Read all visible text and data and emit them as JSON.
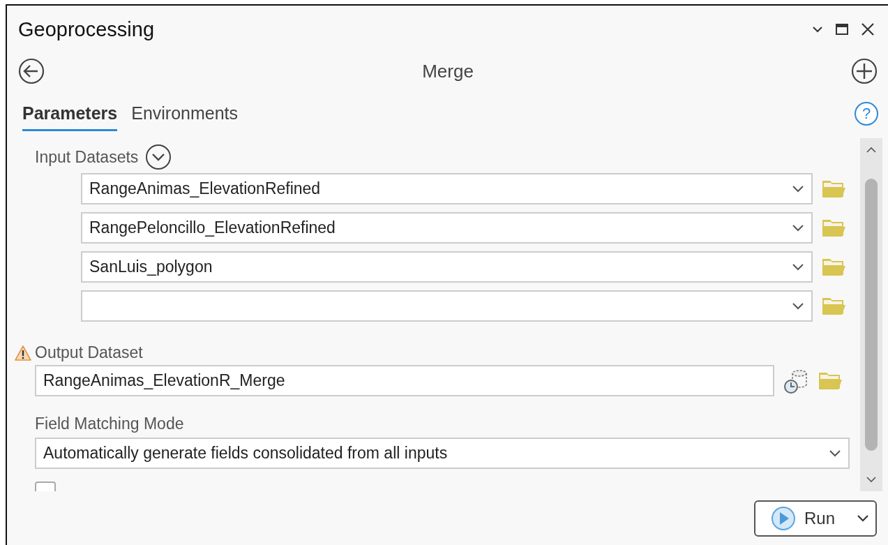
{
  "window": {
    "title": "Geoprocessing"
  },
  "tool": {
    "title": "Merge"
  },
  "tabs": [
    {
      "label": "Parameters",
      "selected": true
    },
    {
      "label": "Environments",
      "selected": false
    }
  ],
  "help_button": {
    "label": "?"
  },
  "input_datasets": {
    "label": "Input Datasets",
    "expanded": true,
    "rows": [
      {
        "value": "RangeAnimas_ElevationRefined"
      },
      {
        "value": "RangePeloncillo_ElevationRefined"
      },
      {
        "value": "SanLuis_polygon"
      },
      {
        "value": ""
      }
    ]
  },
  "output_dataset": {
    "label": "Output Dataset",
    "warning": true,
    "value": "RangeAnimas_ElevationR_Merge"
  },
  "field_matching_mode": {
    "label": "Field Matching Mode",
    "value": "Automatically generate fields consolidated from all inputs"
  },
  "add_source_checkbox": {
    "checked": false
  },
  "run_button": {
    "label": "Run"
  }
}
